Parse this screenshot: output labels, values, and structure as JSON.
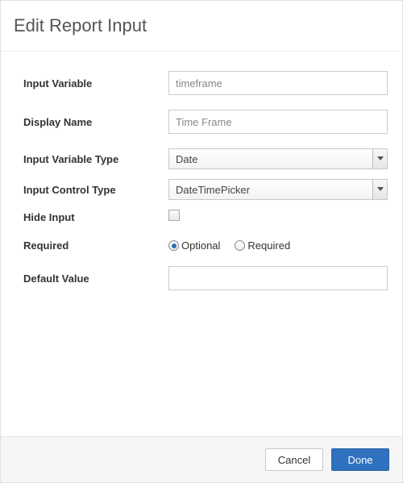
{
  "dialog": {
    "title": "Edit Report Input"
  },
  "labels": {
    "input_variable": "Input Variable",
    "display_name": "Display Name",
    "input_variable_type": "Input Variable Type",
    "input_control_type": "Input Control Type",
    "hide_input": "Hide Input",
    "required": "Required",
    "default_value": "Default Value"
  },
  "fields": {
    "input_variable": "timeframe",
    "display_name": "Time Frame",
    "input_variable_type": "Date",
    "input_control_type": "DateTimePicker",
    "hide_input_checked": false,
    "required_selected": "optional",
    "default_value": ""
  },
  "options": {
    "required": {
      "optional": "Optional",
      "required": "Required"
    }
  },
  "buttons": {
    "cancel": "Cancel",
    "done": "Done"
  }
}
